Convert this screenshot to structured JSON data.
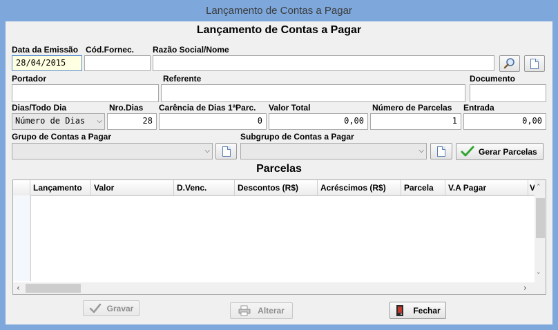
{
  "window": {
    "title": "Lançamento de Contas a Pagar"
  },
  "form": {
    "heading": "Lançamento de Contas a Pagar",
    "labels": {
      "data_emissao": "Data da Emissão",
      "cod_fornec": "Cód.Fornec.",
      "razao_social": "Razão Social/Nome",
      "portador": "Portador",
      "referente": "Referente",
      "documento": "Documento",
      "dias_todo_dia": "Dias/Todo Dia",
      "nro_dias": "Nro.Dias",
      "carencia": "Carência de Dias 1ªParc.",
      "valor_total": "Valor Total",
      "numero_parcelas": "Número de Parcelas",
      "entrada": "Entrada",
      "grupo": "Grupo de Contas a Pagar",
      "subgrupo": "Subgrupo de Contas a Pagar"
    },
    "values": {
      "data_emissao": "28/04/2015",
      "cod_fornec": "",
      "razao_social": "",
      "portador": "",
      "referente": "",
      "documento": "",
      "dias_todo_dia": "Número de Dias",
      "nro_dias": "28",
      "carencia": "0",
      "valor_total": "0,00",
      "numero_parcelas": "1",
      "entrada": "0,00",
      "grupo": "",
      "subgrupo": ""
    },
    "gerar_parcelas_label": "Gerar Parcelas"
  },
  "parcelas": {
    "heading": "Parcelas",
    "columns": [
      "Lançamento",
      "Valor",
      "D.Venc.",
      "Descontos (R$)",
      "Acréscimos (R$)",
      "Parcela",
      "V.A Pagar",
      "V"
    ]
  },
  "footer": {
    "gravar_label": "Gravar",
    "alterar_label": "Alterar",
    "fechar_label": "Fechar"
  },
  "icons": {
    "search": "magnifier-icon",
    "new": "new-document-icon",
    "check": "checkmark-icon",
    "printer": "printer-icon",
    "exit": "exit-door-icon"
  },
  "colors": {
    "titlebar": "#7ea8dc",
    "client": "#f0f0f0",
    "date_field": "#ffffe1",
    "check_green": "#2fa52f",
    "exit_red": "#c0392b"
  }
}
